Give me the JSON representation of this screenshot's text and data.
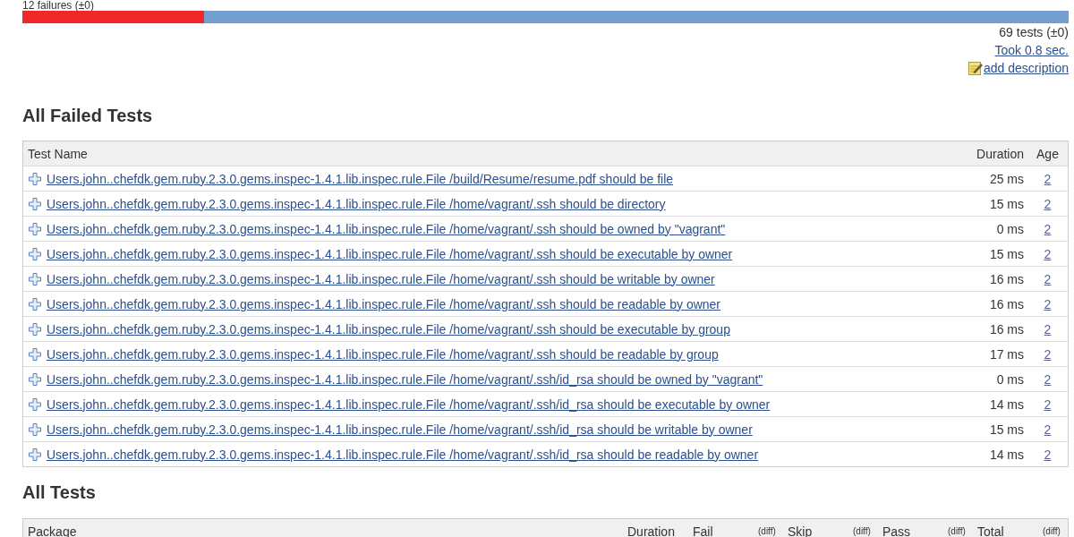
{
  "summary": {
    "failures_label": "12 failures (±0)",
    "bar": {
      "level": 0.174
    },
    "tests_label": "69 tests (±0)",
    "took_link": "Took 0.8 sec.",
    "add_description_link": "add description"
  },
  "failed_tests": {
    "title": "All Failed Tests",
    "columns": [
      {
        "label": "Test Name",
        "kind": "name"
      },
      {
        "label": "Duration",
        "kind": "duration"
      },
      {
        "label": "Age",
        "kind": "age"
      }
    ],
    "rows": [
      {
        "name": "Users.john..chefdk.gem.ruby.2.3.0.gems.inspec-1.4.1.lib.inspec.rule.File /build/Resume/resume.pdf should be file",
        "duration": "25 ms",
        "age": "2"
      },
      {
        "name": "Users.john..chefdk.gem.ruby.2.3.0.gems.inspec-1.4.1.lib.inspec.rule.File /home/vagrant/.ssh should be directory",
        "duration": "15 ms",
        "age": "2"
      },
      {
        "name": "Users.john..chefdk.gem.ruby.2.3.0.gems.inspec-1.4.1.lib.inspec.rule.File /home/vagrant/.ssh should be owned by \"vagrant\"",
        "duration": "0 ms",
        "age": "2"
      },
      {
        "name": "Users.john..chefdk.gem.ruby.2.3.0.gems.inspec-1.4.1.lib.inspec.rule.File /home/vagrant/.ssh should be executable by owner",
        "duration": "15 ms",
        "age": "2"
      },
      {
        "name": "Users.john..chefdk.gem.ruby.2.3.0.gems.inspec-1.4.1.lib.inspec.rule.File /home/vagrant/.ssh should be writable by owner",
        "duration": "16 ms",
        "age": "2"
      },
      {
        "name": "Users.john..chefdk.gem.ruby.2.3.0.gems.inspec-1.4.1.lib.inspec.rule.File /home/vagrant/.ssh should be readable by owner",
        "duration": "16 ms",
        "age": "2"
      },
      {
        "name": "Users.john..chefdk.gem.ruby.2.3.0.gems.inspec-1.4.1.lib.inspec.rule.File /home/vagrant/.ssh should be executable by group",
        "duration": "16 ms",
        "age": "2"
      },
      {
        "name": "Users.john..chefdk.gem.ruby.2.3.0.gems.inspec-1.4.1.lib.inspec.rule.File /home/vagrant/.ssh should be readable by group",
        "duration": "17 ms",
        "age": "2"
      },
      {
        "name": "Users.john..chefdk.gem.ruby.2.3.0.gems.inspec-1.4.1.lib.inspec.rule.File /home/vagrant/.ssh/id_rsa should be owned by \"vagrant\"",
        "duration": "0 ms",
        "age": "2"
      },
      {
        "name": "Users.john..chefdk.gem.ruby.2.3.0.gems.inspec-1.4.1.lib.inspec.rule.File /home/vagrant/.ssh/id_rsa should be executable by owner",
        "duration": "14 ms",
        "age": "2"
      },
      {
        "name": "Users.john..chefdk.gem.ruby.2.3.0.gems.inspec-1.4.1.lib.inspec.rule.File /home/vagrant/.ssh/id_rsa should be writable by owner",
        "duration": "15 ms",
        "age": "2"
      },
      {
        "name": "Users.john..chefdk.gem.ruby.2.3.0.gems.inspec-1.4.1.lib.inspec.rule.File /home/vagrant/.ssh/id_rsa should be readable by owner",
        "duration": "14 ms",
        "age": "2"
      }
    ]
  },
  "all_tests": {
    "title": "All Tests",
    "columns": [
      {
        "label": "Package",
        "kind": "name"
      },
      {
        "label": "Duration",
        "kind": "value"
      },
      {
        "label": "Fail",
        "kind": "value"
      },
      {
        "label": "(diff)",
        "kind": "diff"
      },
      {
        "label": "Skip",
        "kind": "value"
      },
      {
        "label": "(diff)",
        "kind": "diff"
      },
      {
        "label": "Pass",
        "kind": "value"
      },
      {
        "label": "(diff)",
        "kind": "diff"
      },
      {
        "label": "Total",
        "kind": "value"
      },
      {
        "label": "(diff)",
        "kind": "diff"
      }
    ]
  }
}
